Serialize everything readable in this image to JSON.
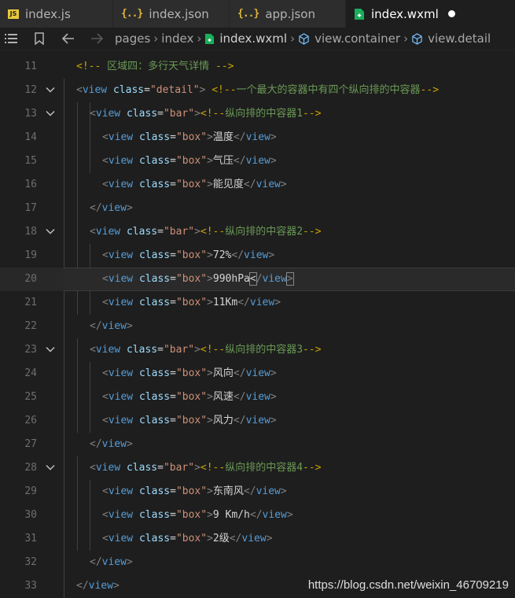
{
  "tabs": [
    {
      "label": "index.js",
      "icon": "js-file-icon"
    },
    {
      "label": "index.json",
      "icon": "json-file-icon"
    },
    {
      "label": "app.json",
      "icon": "json-file-icon"
    },
    {
      "label": "index.wxml",
      "icon": "wxml-file-icon",
      "active": true,
      "dirty": true
    }
  ],
  "breadcrumb": {
    "items": [
      "pages",
      "index",
      "index.wxml",
      "view.container",
      "view.detail"
    ]
  },
  "editor": {
    "active_line": 20,
    "lines": [
      {
        "num": "11",
        "text": "<!-- 区域四：多行天气详情 -->"
      },
      {
        "num": "12",
        "text": "<view class=\"detail\"> <!--一个最大的容器中有四个纵向排的中容器-->"
      },
      {
        "num": "13",
        "text": "<view class=\"bar\"><!--纵向排的中容器1-->"
      },
      {
        "num": "14",
        "text": "<view class=\"box\">温度</view>"
      },
      {
        "num": "15",
        "text": "<view class=\"box\">气压</view>"
      },
      {
        "num": "16",
        "text": "<view class=\"box\">能见度</view>"
      },
      {
        "num": "17",
        "text": "</view>"
      },
      {
        "num": "18",
        "text": "<view class=\"bar\"><!--纵向排的中容器2-->"
      },
      {
        "num": "19",
        "text": "<view class=\"box\">72%</view>"
      },
      {
        "num": "20",
        "text": "<view class=\"box\">990hPa</view>"
      },
      {
        "num": "21",
        "text": "<view class=\"box\">11Km</view>"
      },
      {
        "num": "22",
        "text": "</view>"
      },
      {
        "num": "23",
        "text": "<view class=\"bar\"><!--纵向排的中容器3-->"
      },
      {
        "num": "24",
        "text": "<view class=\"box\">风向</view>"
      },
      {
        "num": "25",
        "text": "<view class=\"box\">风速</view>"
      },
      {
        "num": "26",
        "text": "<view class=\"box\">风力</view>"
      },
      {
        "num": "27",
        "text": "</view>"
      },
      {
        "num": "28",
        "text": "<view class=\"bar\"><!--纵向排的中容器4-->"
      },
      {
        "num": "29",
        "text": "<view class=\"box\">东南风</view>"
      },
      {
        "num": "30",
        "text": "<view class=\"box\">9 Km/h</view>"
      },
      {
        "num": "31",
        "text": "<view class=\"box\">2级</view>"
      },
      {
        "num": "32",
        "text": "</view>"
      },
      {
        "num": "33",
        "text": "</view>"
      }
    ]
  },
  "watermark": "https://blog.csdn.net/weixin_46709219",
  "colors": {
    "tag": "#569cd6",
    "attr": "#9cdcfe",
    "string": "#ce9178",
    "comment": "#6a9955",
    "background": "#1e1e1e"
  }
}
